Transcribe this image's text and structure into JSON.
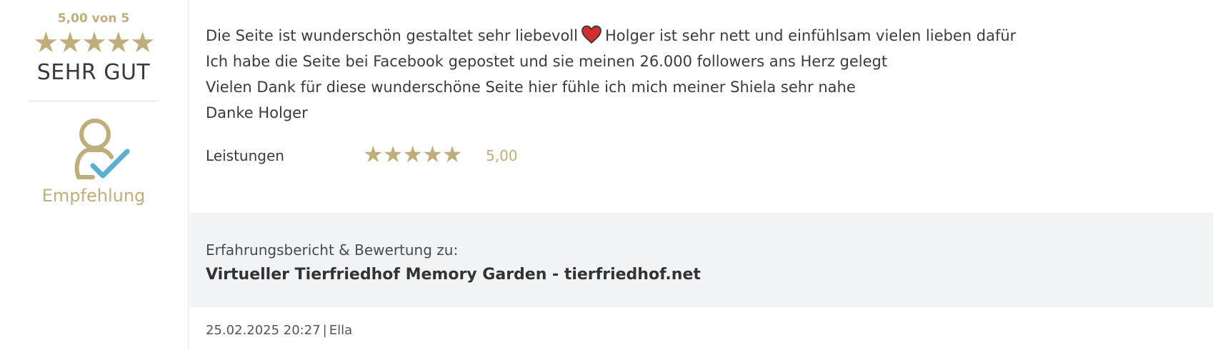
{
  "summary": {
    "score_text": "5,00 von 5",
    "stars": "★★★★★",
    "verdict": "SEHR GUT",
    "recommendation_label": "Empfehlung"
  },
  "review": {
    "line1_before": "Die Seite ist wunderschön gestaltet sehr liebevoll",
    "line1_after": "Holger ist sehr nett und einfühlsam vielen lieben dafür",
    "line2": "Ich habe die Seite bei Facebook gepostet und sie meinen 26.000 followers ans Herz gelegt",
    "line3": "Vielen Dank für diese wunderschöne Seite hier fühle ich mich meiner Shiela sehr nahe",
    "line4": "Danke Holger"
  },
  "rating": {
    "label": "Leistungen",
    "stars": "★★★★★",
    "value": "5,00"
  },
  "subject": {
    "caption": "Erfahrungsbericht & Bewertung zu:",
    "title": "Virtueller Tierfriedhof Memory Garden - tierfriedhof.net"
  },
  "meta": {
    "datetime": "25.02.2025 20:27",
    "separator": "|",
    "author": "Ella"
  },
  "colors": {
    "accent_gold": "#bfae7c",
    "check_blue": "#5aaed0",
    "heart_red": "#d32f2f",
    "panel_gray": "#f2f3f5"
  },
  "icons": {
    "recommendation": "person-check-icon",
    "heart": "heart-icon"
  }
}
